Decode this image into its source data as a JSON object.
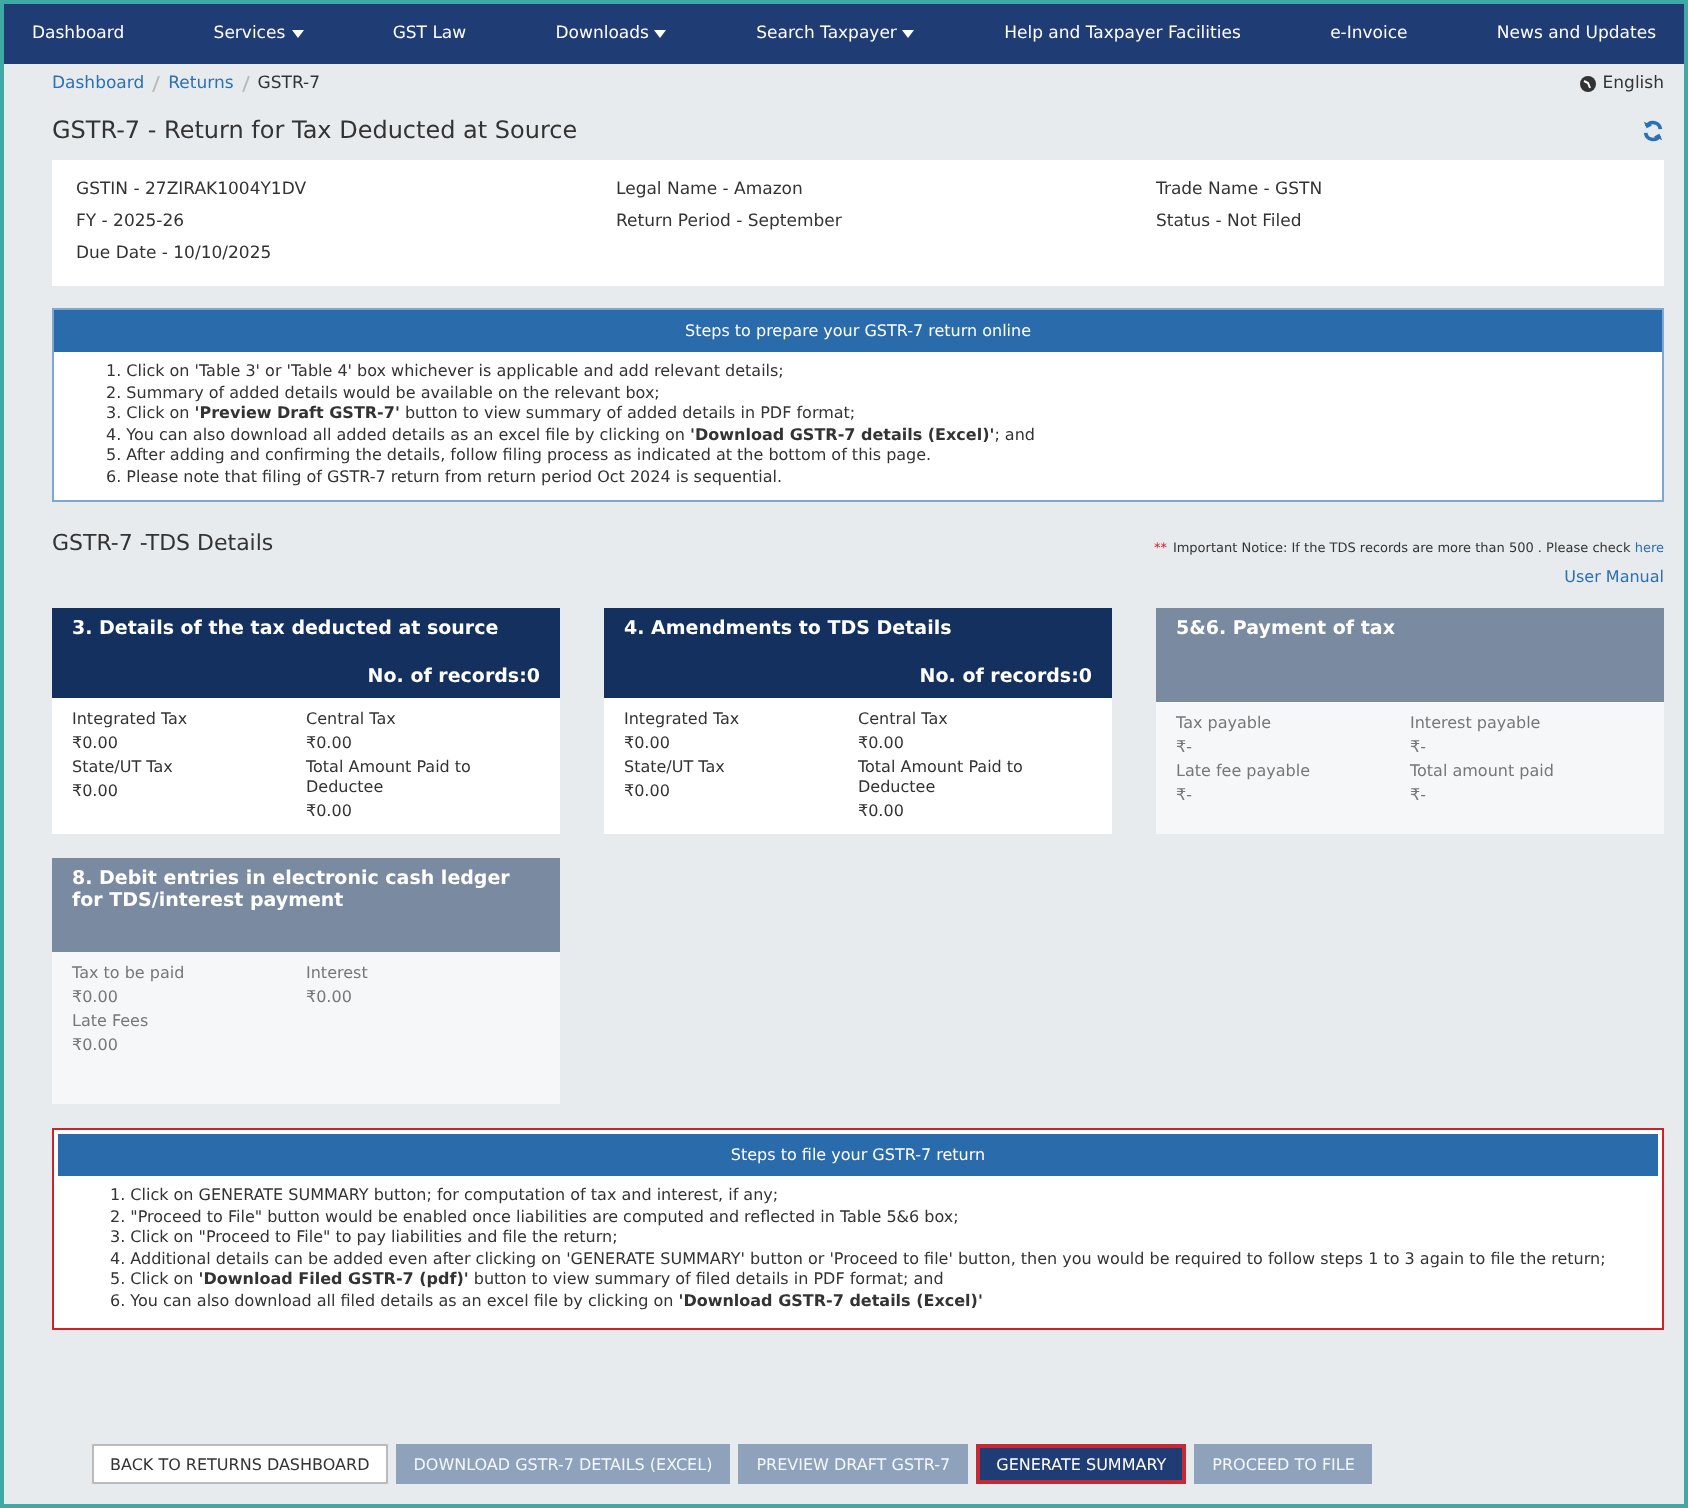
{
  "nav": [
    {
      "label": "Dashboard",
      "dropdown": false
    },
    {
      "label": "Services",
      "dropdown": true
    },
    {
      "label": "GST Law",
      "dropdown": false
    },
    {
      "label": "Downloads",
      "dropdown": true
    },
    {
      "label": "Search Taxpayer",
      "dropdown": true
    },
    {
      "label": "Help and Taxpayer Facilities",
      "dropdown": false
    },
    {
      "label": "e-Invoice",
      "dropdown": false
    },
    {
      "label": "News and Updates",
      "dropdown": false
    }
  ],
  "breadcrumb": [
    "Dashboard",
    "Returns",
    "GSTR-7"
  ],
  "language": "English",
  "page_title": "GSTR-7 - Return for Tax Deducted at Source",
  "info": [
    "GSTIN - 27ZIRAK1004Y1DV",
    "Legal Name - Amazon",
    "Trade Name - GSTN",
    "FY - 2025-26",
    "Return Period - September",
    "Status - Not Filed",
    "Due Date - 10/10/2025"
  ],
  "prepare_steps": {
    "title": "Steps to prepare your GSTR-7 return online",
    "items": [
      "1. Click on 'Table 3' or 'Table 4' box whichever is applicable and add relevant details;",
      "2. Summary of added details would be available on the relevant box;",
      "3. Click on **'Preview Draft GSTR-7'** button to view summary of added details in PDF format;",
      "4. You can also download all added details as an excel file by clicking on **'Download GSTR-7 details (Excel)'**; and",
      "5. After adding and confirming the details, follow filing process as indicated at the bottom of this page.",
      "6. Please note that filing of GSTR-7 return from return period Oct 2024 is sequential."
    ]
  },
  "tds": {
    "title": "GSTR-7 -TDS Details",
    "notice_mark": "**",
    "notice": "Important Notice: If the TDS records are more than 500 . Please check",
    "notice_link": "here",
    "user_manual": "User Manual"
  },
  "tiles": [
    {
      "title": "3. Details of the tax deducted at source",
      "records": "No. of records:0",
      "disabled": false,
      "fields": [
        {
          "label": "Integrated Tax",
          "value": "₹0.00"
        },
        {
          "label": "Central Tax",
          "value": "₹0.00"
        },
        {
          "label": "State/UT Tax",
          "value": "₹0.00"
        },
        {
          "label": "Total Amount Paid to Deductee",
          "value": "₹0.00"
        }
      ]
    },
    {
      "title": "4. Amendments to TDS Details",
      "records": "No. of records:0",
      "disabled": false,
      "fields": [
        {
          "label": "Integrated Tax",
          "value": "₹0.00"
        },
        {
          "label": "Central Tax",
          "value": "₹0.00"
        },
        {
          "label": "State/UT Tax",
          "value": "₹0.00"
        },
        {
          "label": "Total Amount Paid to Deductee",
          "value": "₹0.00"
        }
      ]
    },
    {
      "title": "5&6. Payment of tax",
      "disabled": true,
      "fields": [
        {
          "label": "Tax payable",
          "value": "₹-"
        },
        {
          "label": "Interest payable",
          "value": "₹-"
        },
        {
          "label": "Late fee payable",
          "value": "₹-"
        },
        {
          "label": "Total amount paid",
          "value": "₹-"
        }
      ]
    },
    {
      "title": "8. Debit entries in electronic cash ledger for TDS/interest payment",
      "disabled": true,
      "fields": [
        {
          "label": "Tax to be paid",
          "value": "₹0.00"
        },
        {
          "label": "Interest",
          "value": "₹0.00"
        },
        {
          "label": "Late Fees",
          "value": "₹0.00"
        }
      ]
    }
  ],
  "file_steps": {
    "title": "Steps to file your GSTR-7 return",
    "items": [
      "1. Click on GENERATE SUMMARY button; for computation of tax and interest, if any;",
      "2. \"Proceed to File\" button would be enabled once liabilities are computed and reflected in Table 5&6 box;",
      "3. Click on \"Proceed to File\" to pay liabilities and file the return;",
      "4. Additional details can be added even after clicking on 'GENERATE SUMMARY' button or 'Proceed to file' button, then you would be required to follow steps 1 to 3 again to file the return;",
      "5. Click on **'Download Filed GSTR-7 (pdf)'** button to view summary of filed details in PDF format; and",
      "6. You can also download all filed details as an excel file by clicking on **'Download GSTR-7 details (Excel)'**"
    ]
  },
  "buttons": [
    {
      "label": "BACK TO RETURNS DASHBOARD",
      "kind": "outline"
    },
    {
      "label": "DOWNLOAD GSTR-7 DETAILS (EXCEL)",
      "kind": "disabled"
    },
    {
      "label": "PREVIEW DRAFT GSTR-7",
      "kind": "disabled"
    },
    {
      "label": "GENERATE SUMMARY",
      "kind": "primary"
    },
    {
      "label": "PROCEED TO FILE",
      "kind": "disabled"
    }
  ]
}
